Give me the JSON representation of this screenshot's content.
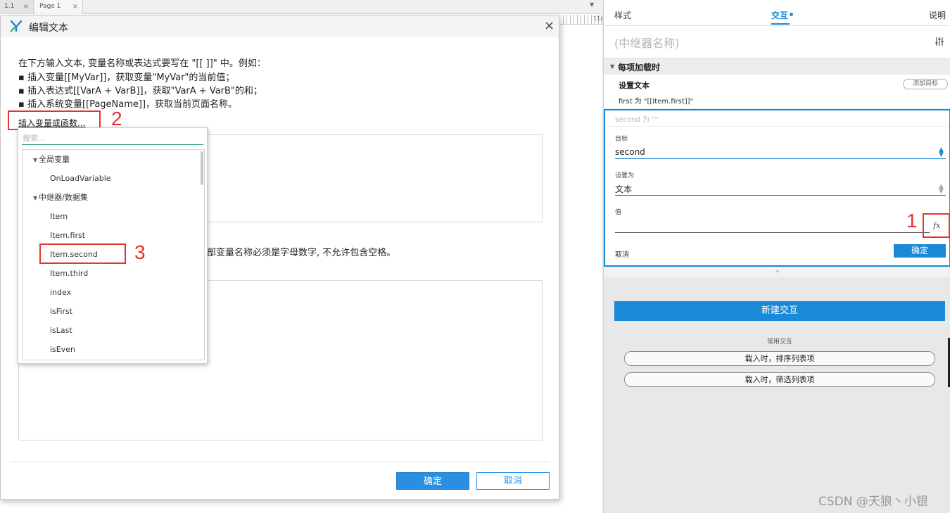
{
  "workspace": {
    "tabs": [
      {
        "label": "1.1",
        "close": "×"
      },
      {
        "label": "Page 1",
        "close": "×"
      }
    ],
    "tab_dropdown": "▼",
    "ruler_number": "11("
  },
  "dialog": {
    "title": "编辑文本",
    "close": "×",
    "instructions": [
      "在下方输入文本, 变量名称或表达式要写在 \"[[ ]]\" 中。例如：",
      "▪ 插入变量[[MyVar]]，获取变量\"MyVar\"的当前值；",
      "▪ 插入表达式[[VarA + VarB]]，获取\"VarA + VarB\"的和；",
      "▪ 插入系统变量[[PageName]]，获取当前页面名称。"
    ],
    "insert_link": "插入变量或函数...",
    "local_var_note": "部变量名称必须是字母数字, 不允许包含空格。",
    "ok_label": "确定",
    "cancel_label": "取消"
  },
  "popup": {
    "search_placeholder": "搜索...",
    "groups": [
      {
        "label": "全局变量",
        "items": [
          "OnLoadVariable"
        ]
      },
      {
        "label": "中继器/数据集",
        "items": [
          "Item",
          "Item.first",
          "Item.second",
          "Item.third",
          "index",
          "isFirst",
          "isLast",
          "isEven"
        ]
      }
    ]
  },
  "annotations": {
    "one": "1",
    "two": "2",
    "three": "3"
  },
  "panel": {
    "tabs": {
      "style": "样式",
      "interactions": "交互",
      "notes": "说明"
    },
    "repeater_name": "(中继器名称)",
    "event": {
      "title": "每项加载时",
      "action_title": "设置文本",
      "add_target": "添加目标",
      "first_line": "first 为 \"[[Item.first]]\""
    },
    "editor": {
      "summary": "second 为 \"\"",
      "target_label": "目标",
      "target_value": "second",
      "setto_label": "设置为",
      "setto_value": "文本",
      "value_label": "值",
      "value_value": "",
      "fx": "fx",
      "cancel": "取消",
      "ok": "确定"
    },
    "add_handle": "+",
    "new_interaction": "新建交互",
    "common_label": "常用交互",
    "common_actions": [
      "载入时，排序列表项",
      "载入时，筛选列表项"
    ]
  },
  "watermark": "CSDN @天狼丶小银",
  "colors": {
    "accent": "#1a8ad8",
    "annotation": "#e53333",
    "dialog_ok": "#2a8fe0"
  }
}
